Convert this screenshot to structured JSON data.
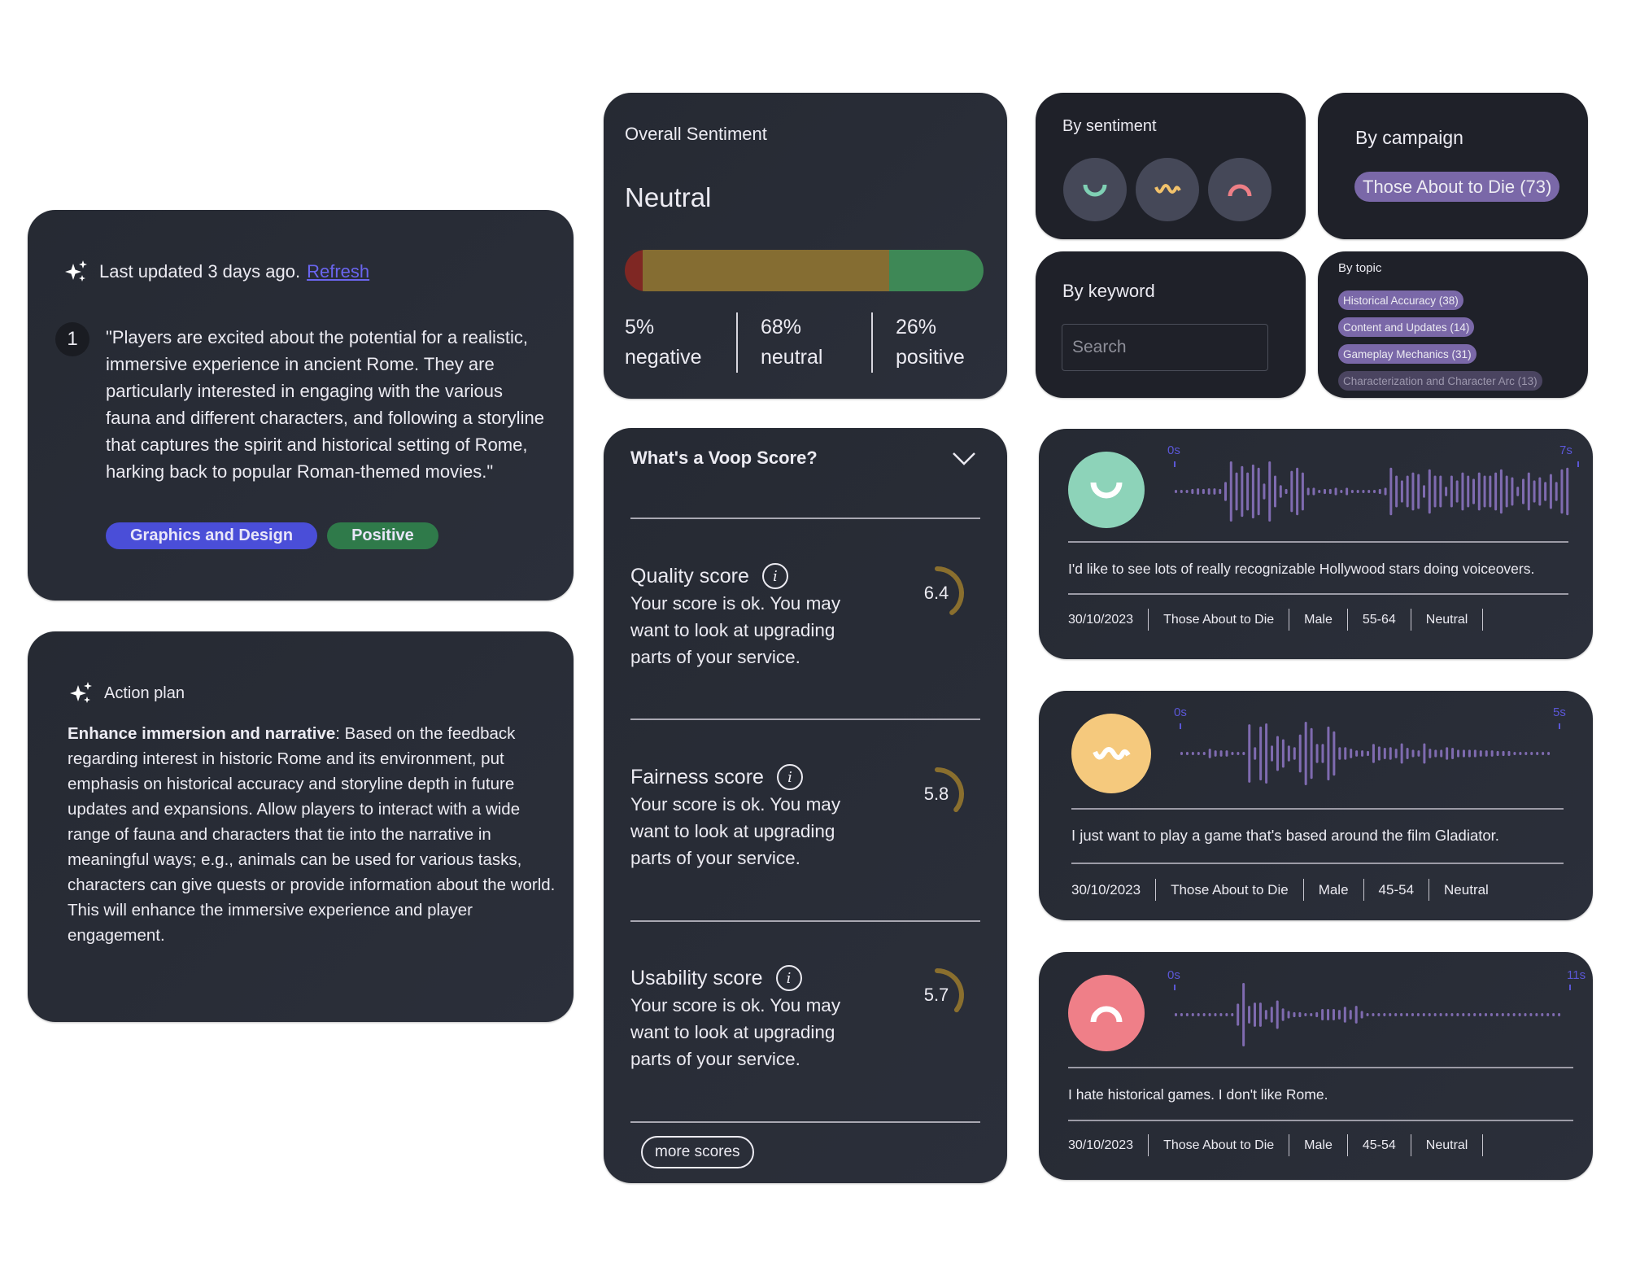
{
  "summary": {
    "last_updated": "Last updated 3 days ago.",
    "refresh_label": "Refresh",
    "item_number": "1",
    "quote": "\"Players are excited about the potential for a realistic, immersive experience in ancient Rome. They are particularly interested in engaging with the various fauna and different characters, and following a storyline that captures the spirit and historical setting of Rome, harking back to popular Roman-themed movies.\"",
    "tags": [
      {
        "label": "Graphics and Design",
        "color": "#4a4ed8"
      },
      {
        "label": "Positive",
        "color": "#2f7a4a"
      }
    ]
  },
  "action_plan": {
    "title": "Action plan",
    "heading": "Enhance immersion and narrative",
    "body": ": Based on the feedback regarding interest in historic Rome and its environment, put emphasis on historical accuracy and storyline depth in future updates and expansions. Allow players to interact with a wide range of fauna and characters that tie into the narrative in meaningful ways; e.g., animals can be used for various tasks, characters can give quests or provide information about the world. This will enhance the immersive experience and player engagement."
  },
  "overall_sentiment": {
    "title": "Overall Sentiment",
    "value": "Neutral",
    "segments": [
      {
        "name": "negative",
        "percent": 5,
        "color": "#7f2723"
      },
      {
        "name": "neutral",
        "percent": 68,
        "color": "#856d32"
      },
      {
        "name": "positive",
        "percent": 26,
        "color": "#3e8856"
      }
    ],
    "stats": [
      {
        "pct": "5%",
        "label": "negative"
      },
      {
        "pct": "68%",
        "label": "neutral"
      },
      {
        "pct": "26%",
        "label": "positive"
      }
    ]
  },
  "voop": {
    "header": "What's a Voop Score?",
    "gauge_color": "#8a6f2e",
    "scores": [
      {
        "title": "Quality score",
        "value": "6.4",
        "fraction": 0.64,
        "desc": "Your score is ok. You may want to look at upgrading parts of your service."
      },
      {
        "title": "Fairness score",
        "value": "5.8",
        "fraction": 0.58,
        "desc": "Your score is ok. You may want to look at upgrading parts of your service."
      },
      {
        "title": "Usability score",
        "value": "5.7",
        "fraction": 0.57,
        "desc": "Your score is ok. You may want to look at upgrading parts of your service."
      }
    ],
    "more_label": "more scores"
  },
  "filters": {
    "sentiment": {
      "label": "By sentiment",
      "options": [
        {
          "name": "positive",
          "color": "#7fd0b4"
        },
        {
          "name": "neutral",
          "color": "#f2c26b"
        },
        {
          "name": "negative",
          "color": "#ee7f86"
        }
      ]
    },
    "campaign": {
      "label": "By campaign",
      "chip": "Those About to Die (73)"
    },
    "keyword": {
      "label": "By keyword",
      "placeholder": "Search"
    },
    "topic": {
      "label": "By topic",
      "chips": [
        "Historical Accuracy (38)",
        "Content and Updates (14)",
        "Gameplay Mechanics (31)",
        "Characterization and Character Arc (13)"
      ]
    }
  },
  "responses": [
    {
      "sentiment": "positive",
      "face_color": "#8dd3b9",
      "start": "0s",
      "end": "7s",
      "amplitudes": [
        0.05,
        0.05,
        0.05,
        0.08,
        0.1,
        0.08,
        0.1,
        0.1,
        0.08,
        0.3,
        0.95,
        0.6,
        0.8,
        0.6,
        0.85,
        0.75,
        0.25,
        0.95,
        0.5,
        0.2,
        0.08,
        0.65,
        0.75,
        0.6,
        0.12,
        0.12,
        0.05,
        0.08,
        0.08,
        0.12,
        0.05,
        0.12,
        0.05,
        0.05,
        0.05,
        0.05,
        0.05,
        0.08,
        0.12,
        0.75,
        0.5,
        0.35,
        0.5,
        0.6,
        0.55,
        0.2,
        0.7,
        0.5,
        0.5,
        0.15,
        0.5,
        0.35,
        0.6,
        0.5,
        0.4,
        0.6,
        0.5,
        0.5,
        0.6,
        0.7,
        0.5,
        0.45,
        0.15,
        0.4,
        0.6,
        0.35,
        0.45,
        0.3,
        0.55,
        0.3,
        0.7,
        0.75
      ],
      "text": "I'd like to see lots of really recognizable Hollywood stars doing voiceovers.",
      "meta": [
        "30/10/2023",
        "Those About to Die",
        "Male",
        "55-64",
        "Neutral"
      ]
    },
    {
      "sentiment": "neutral",
      "face_color": "#f5c97d",
      "start": "0s",
      "end": "5s",
      "amplitudes": [
        0.05,
        0.05,
        0.05,
        0.05,
        0.05,
        0.15,
        0.1,
        0.1,
        0.1,
        0.05,
        0.05,
        0.05,
        0.92,
        0.2,
        0.85,
        0.95,
        0.25,
        0.55,
        0.45,
        0.25,
        0.2,
        0.6,
        1.0,
        0.8,
        0.3,
        0.3,
        0.85,
        0.7,
        0.2,
        0.2,
        0.15,
        0.1,
        0.1,
        0.08,
        0.3,
        0.22,
        0.18,
        0.2,
        0.15,
        0.32,
        0.18,
        0.12,
        0.1,
        0.32,
        0.15,
        0.12,
        0.12,
        0.2,
        0.18,
        0.12,
        0.12,
        0.12,
        0.12,
        0.1,
        0.1,
        0.1,
        0.08,
        0.08,
        0.08,
        0.05,
        0.05,
        0.05,
        0.05,
        0.05,
        0.05,
        0.05
      ],
      "text": "I just want to play a game that's based around the film Gladiator.",
      "meta": [
        "30/10/2023",
        "Those About to Die",
        "Male",
        "45-54",
        "Neutral"
      ]
    },
    {
      "sentiment": "negative",
      "face_color": "#ef7f88",
      "start": "0s",
      "end": "11s",
      "amplitudes": [
        0.05,
        0.05,
        0.05,
        0.05,
        0.05,
        0.05,
        0.05,
        0.05,
        0.05,
        0.05,
        0.05,
        0.35,
        1.0,
        0.28,
        0.38,
        0.38,
        0.15,
        0.25,
        0.45,
        0.2,
        0.12,
        0.08,
        0.08,
        0.05,
        0.05,
        0.08,
        0.18,
        0.18,
        0.18,
        0.15,
        0.25,
        0.15,
        0.28,
        0.12,
        0.05,
        0.05,
        0.05,
        0.05,
        0.05,
        0.05,
        0.05,
        0.05,
        0.05,
        0.05,
        0.05,
        0.05,
        0.05,
        0.05,
        0.05,
        0.05,
        0.05,
        0.05,
        0.05,
        0.05,
        0.05,
        0.05,
        0.05,
        0.05,
        0.05,
        0.05,
        0.05,
        0.05,
        0.05,
        0.05,
        0.05,
        0.05,
        0.05,
        0.05,
        0.05
      ],
      "text": "I hate historical games. I don't like Rome.",
      "meta": [
        "30/10/2023",
        "Those About to Die",
        "Male",
        "45-54",
        "Neutral"
      ]
    }
  ],
  "wave_color": "#7f6bb0"
}
